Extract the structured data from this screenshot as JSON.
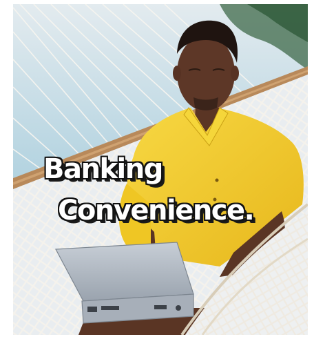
{
  "headline": {
    "line1": "Banking",
    "line2": "Convenience."
  },
  "colors": {
    "sky": "#cfe0ea",
    "water": "#8fc1d6",
    "shirt": "#f2cc2a",
    "skin": "#5a3524",
    "laptop": "#b4bcc6",
    "hammock_rope": "#f4f1ea",
    "hammock_bar": "#b8895a"
  },
  "photo": {
    "subject": "man-in-hammock-with-laptop-icon"
  }
}
